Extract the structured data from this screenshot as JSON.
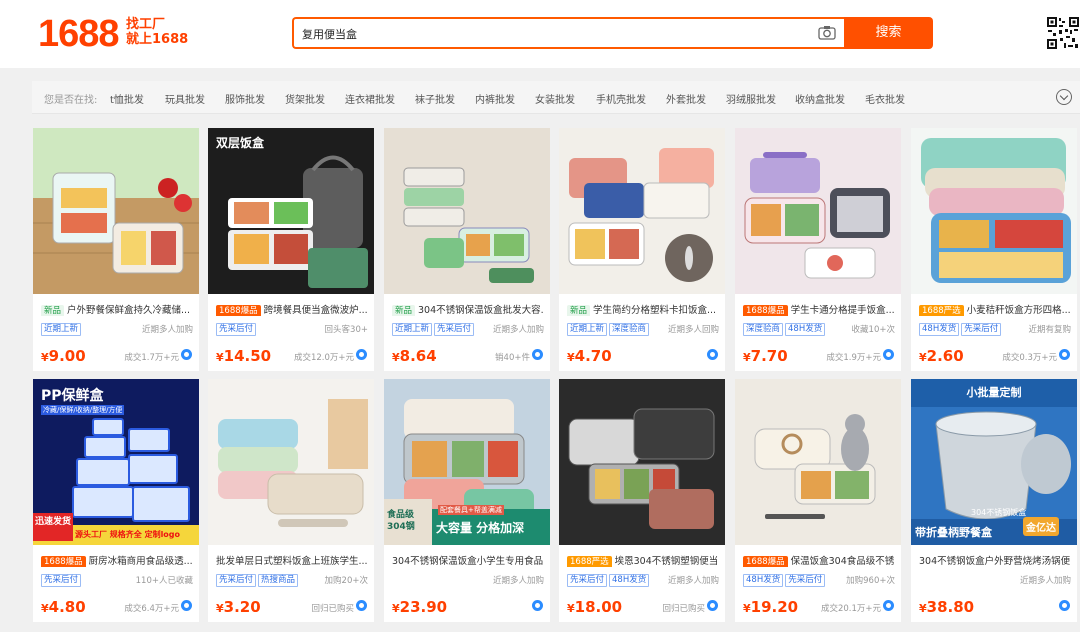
{
  "header": {
    "logo": "1688",
    "slogan_line1": "找工厂",
    "slogan_line2": "就上1688",
    "search_value": "复用便当盒",
    "search_button": "搜索",
    "camera_icon": "camera-icon",
    "qr_icon": "qr-code-icon"
  },
  "filters": {
    "label": "您是否在找:",
    "items": [
      "t恤批发",
      "玩具批发",
      "服饰批发",
      "货架批发",
      "连衣裙批发",
      "袜子批发",
      "内裤批发",
      "女装批发",
      "手机壳批发",
      "外套批发",
      "羽绒服批发",
      "收纳盒批发",
      "毛衣批发"
    ],
    "expand_icon": "chevron-down-icon"
  },
  "products": [
    {
      "badge": "新品",
      "badge_type": "new",
      "title": "户外野餐保鲜盒持久冷藏储...",
      "services": [
        "近期上新"
      ],
      "note": "近期多人加购",
      "price": "9.00",
      "sold": "成交1.7万+元"
    },
    {
      "badge": "1688爆品",
      "badge_type": "hot",
      "title": "跨境餐具便当盒微波炉...",
      "services": [
        "先采后付"
      ],
      "note": "回头客30+",
      "price": "14.50",
      "sold": "成交12.0万+元"
    },
    {
      "badge": "新品",
      "badge_type": "new",
      "title": "304不锈钢保温饭盒批发大容...",
      "services": [
        "近期上新",
        "先采后付"
      ],
      "note": "近期多人加购",
      "price": "8.64",
      "sold": "销40+件"
    },
    {
      "badge": "新品",
      "badge_type": "new",
      "title": "学生简约分格塑料卡扣饭盒...",
      "services": [
        "近期上新",
        "深度验商"
      ],
      "note": "近期多人回购",
      "price": "4.70",
      "sold": ""
    },
    {
      "badge": "1688爆品",
      "badge_type": "hot",
      "title": "学生卡通分格提手饭盒...",
      "services": [
        "深度验商",
        "48H发货"
      ],
      "note": "收藏10+次",
      "price": "7.70",
      "sold": "成交1.9万+元"
    },
    {
      "badge": "1688严选",
      "badge_type": "pick",
      "title": "小麦秸秆饭盒方形四格...",
      "services": [
        "48H发货",
        "先采后付"
      ],
      "note": "近期有复购",
      "price": "2.60",
      "sold": "成交0.3万+元"
    },
    {
      "badge": "1688爆品",
      "badge_type": "hot",
      "title": "厨房冰箱商用食品级透...",
      "services": [
        "先采后付"
      ],
      "note": "110+人已收藏",
      "price": "4.80",
      "sold": "成交6.4万+元"
    },
    {
      "badge": "",
      "badge_type": "",
      "title": "批发单层日式塑料饭盒上班族学生...",
      "services": [
        "先采后付",
        "热搜商品"
      ],
      "note": "加购20+次",
      "price": "3.20",
      "sold": "回归已购买"
    },
    {
      "badge": "",
      "badge_type": "",
      "title": "304不锈钢保温饭盒小学生专用食品...",
      "services": [],
      "note": "近期多人加购",
      "price": "23.90",
      "sold": ""
    },
    {
      "badge": "1688严选",
      "badge_type": "pick",
      "title": "埃恩304不锈钢塑钢便当...",
      "services": [
        "先采后付",
        "48H发货"
      ],
      "note": "近期多人加购",
      "price": "18.00",
      "sold": "回归已购买"
    },
    {
      "badge": "1688爆品",
      "badge_type": "hot",
      "title": "保温饭盒304食品级不锈...",
      "services": [
        "48H发货",
        "先采后付"
      ],
      "note": "加购960+次",
      "price": "19.20",
      "sold": "成交20.1万+元"
    },
    {
      "badge": "",
      "badge_type": "",
      "title": "304不锈钢饭盒户外野营烧烤汤锅便...",
      "services": [],
      "note": "近期多人加购",
      "price": "38.80",
      "sold": ""
    }
  ],
  "image_text": {
    "p2": "双层饭盒",
    "p7_top": "PP保鲜盒",
    "p7_sub": "冷藏/保鲜/收纳/整理/方便",
    "p7_badge": "迅速发货",
    "p7_banner": "源头工厂 规格齐全 定制logo",
    "p9_badge": "食品级304钢",
    "p9_banner": "大容量 分格加深",
    "p9_banner_top": "配套餐具+帮盖满减",
    "p12_top": "小批量定制",
    "p12_mid": "304不锈钢饭盒",
    "p12_banner": "带折叠柄野餐盒",
    "p12_brand": "金亿达"
  },
  "currency": "¥"
}
